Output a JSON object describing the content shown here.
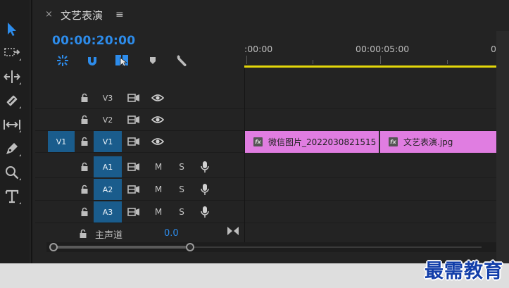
{
  "tools": [
    {
      "name": "selection-tool"
    },
    {
      "name": "track-select-tool"
    },
    {
      "name": "ripple-edit-tool"
    },
    {
      "name": "razor-tool"
    },
    {
      "name": "slip-tool"
    },
    {
      "name": "pen-tool"
    },
    {
      "name": "zoom-tool"
    },
    {
      "name": "type-tool"
    }
  ],
  "panel": {
    "close_label": "×",
    "title": "文艺表演",
    "menu_label": "≡"
  },
  "timecode": "00:00:20:00",
  "ruler": {
    "labels": [
      ":00:00",
      "00:00:05:00",
      "0"
    ]
  },
  "tracks": {
    "video": [
      {
        "label": "V3",
        "source_patch": "",
        "targeted": false
      },
      {
        "label": "V2",
        "source_patch": "",
        "targeted": false
      },
      {
        "label": "V1",
        "source_patch": "V1",
        "targeted": true
      }
    ],
    "audio": [
      {
        "label": "A1",
        "mute": "M",
        "solo": "S",
        "targeted": true
      },
      {
        "label": "A2",
        "mute": "M",
        "solo": "S",
        "targeted": true
      },
      {
        "label": "A3",
        "mute": "M",
        "solo": "S",
        "targeted": true
      }
    ]
  },
  "clips": [
    {
      "fx": "fx",
      "name": "微信图片_2022030821515"
    },
    {
      "fx": "fx",
      "name": "文艺表演.jpg"
    }
  ],
  "master": {
    "label": "主声道",
    "value": "0.0"
  },
  "watermark": "最需教育",
  "colors": {
    "accent": "#2d8ceb",
    "target_patch": "#1a5c8c",
    "clip": "#e07de1",
    "work_area": "#e3d70a",
    "watermark": "#123ea9"
  }
}
